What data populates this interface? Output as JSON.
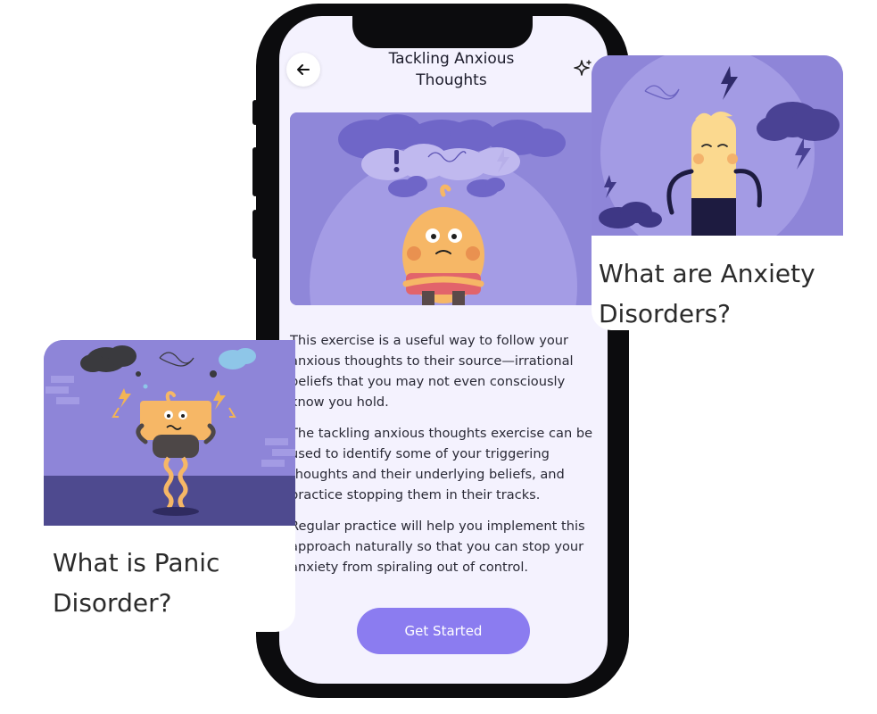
{
  "screen": {
    "header": {
      "title": "Tackling Anxious Thoughts"
    },
    "description": [
      "This exercise is a useful way to follow your anxious thoughts to their source—irrational beliefs that you may not even consciously know you hold.",
      "The tackling anxious thoughts exercise can be used to identify some of your triggering thoughts and their underlying beliefs, and practice stopping them in their tracks.",
      "Regular practice will help you implement this approach naturally so that you can stop your anxiety from spiraling out of control."
    ],
    "cta_label": "Get Started"
  },
  "cards": {
    "right": {
      "title": "What are Anxiety Disorders?"
    },
    "left": {
      "title": "What is Panic Disorder?"
    }
  },
  "icons": {
    "back": "arrow-left-icon",
    "sparkle": "sparkle-icon"
  },
  "colors": {
    "accent": "#8b7cf0",
    "illustration_bg": "#8f87d9",
    "screen_bg": "#f4f2fe",
    "character": "#f6b766"
  }
}
